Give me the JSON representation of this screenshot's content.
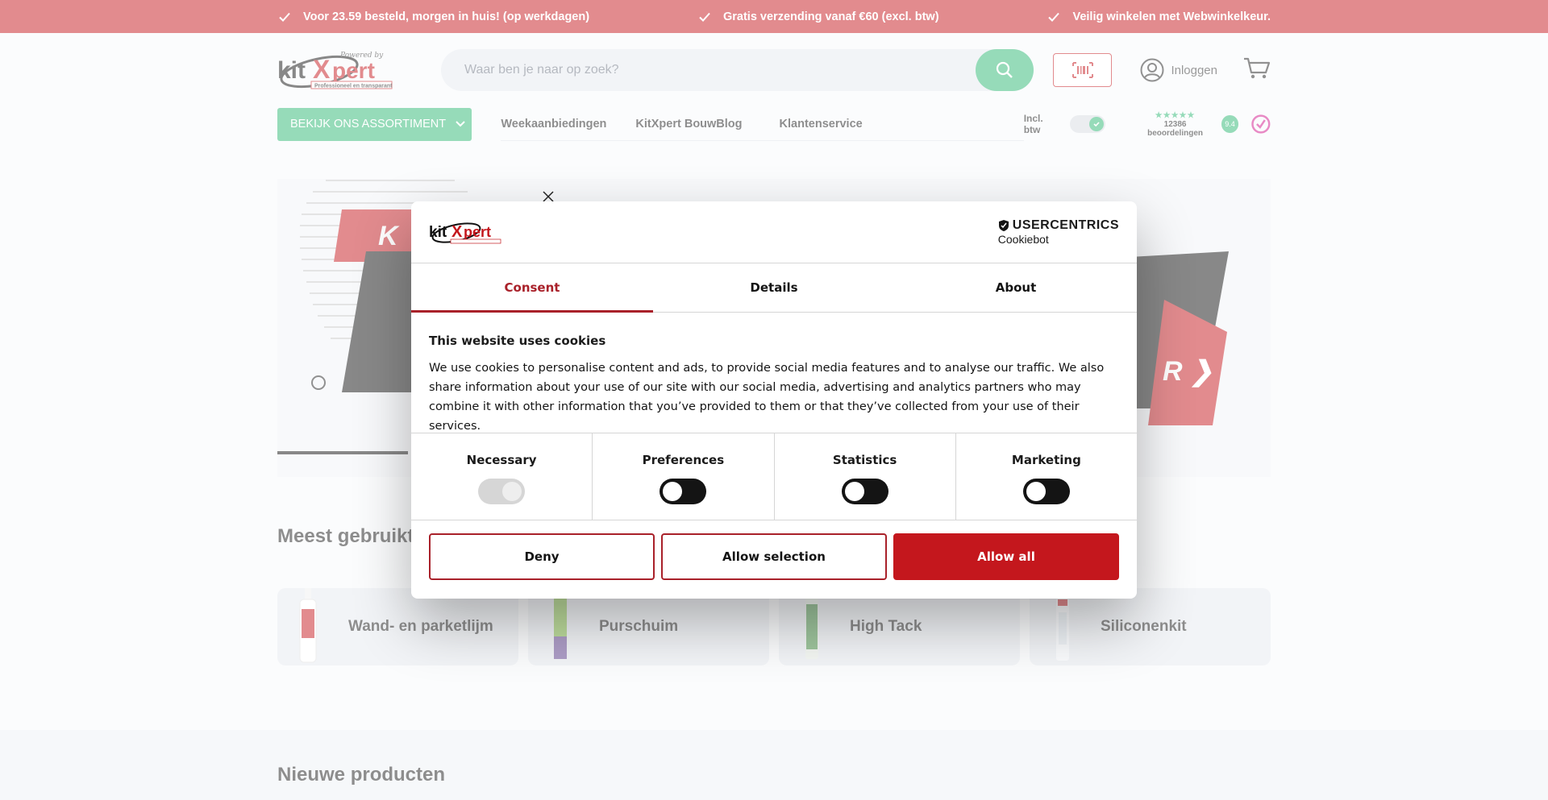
{
  "topbar": {
    "usps": [
      "Voor 23.59 besteld, morgen in huis! (op werkdagen)",
      "Gratis verzending vanaf €60 (excl. btw)",
      "Veilig winkelen met Webwinkelkeur."
    ]
  },
  "header": {
    "logo_text": "kitXpert",
    "logo_tagline": "Professioneel en transparant",
    "search_placeholder": "Waar ben je naar op zoek?",
    "login_label": "Inloggen"
  },
  "nav": {
    "assortment_button": "BEKIJK ONS ASSORTIMENT",
    "links": [
      "Weekaanbiedingen",
      "KitXpert BouwBlog",
      "Klantenservice"
    ],
    "vat_label": "Incl. btw",
    "vat_on": true,
    "reviews_count": "12386 beoordelingen",
    "rating": "9.4"
  },
  "sections": {
    "most_used": "Meest gebruikt",
    "new_products": "Nieuwe producten"
  },
  "categories": [
    {
      "label": "Wand- en parketlijm"
    },
    {
      "label": "Purschuim"
    },
    {
      "label": "High Tack"
    },
    {
      "label": "Siliconenkit"
    }
  ],
  "cookie_dialog": {
    "brand_top": "USERCENTRICS",
    "brand_bottom": "Cookiebot",
    "tabs": [
      {
        "label": "Consent",
        "active": true
      },
      {
        "label": "Details",
        "active": false
      },
      {
        "label": "About",
        "active": false
      }
    ],
    "title": "This website uses cookies",
    "text": "We use cookies to personalise content and ads, to provide social media features and to analyse our traffic. We also share information about your use of our site with our social media, advertising and analytics partners who may combine it with other information that you’ve provided to them or that they’ve collected from your use of their services.",
    "categories": [
      {
        "label": "Necessary",
        "enabled": true,
        "locked": true
      },
      {
        "label": "Preferences",
        "enabled": false,
        "locked": false
      },
      {
        "label": "Statistics",
        "enabled": false,
        "locked": false
      },
      {
        "label": "Marketing",
        "enabled": false,
        "locked": false
      }
    ],
    "buttons": {
      "deny": "Deny",
      "allow_selection": "Allow selection",
      "allow_all": "Allow all"
    }
  },
  "colors": {
    "brand_red": "#c4171d",
    "brand_green": "#2cb673",
    "consent_accent": "#a9212a"
  }
}
